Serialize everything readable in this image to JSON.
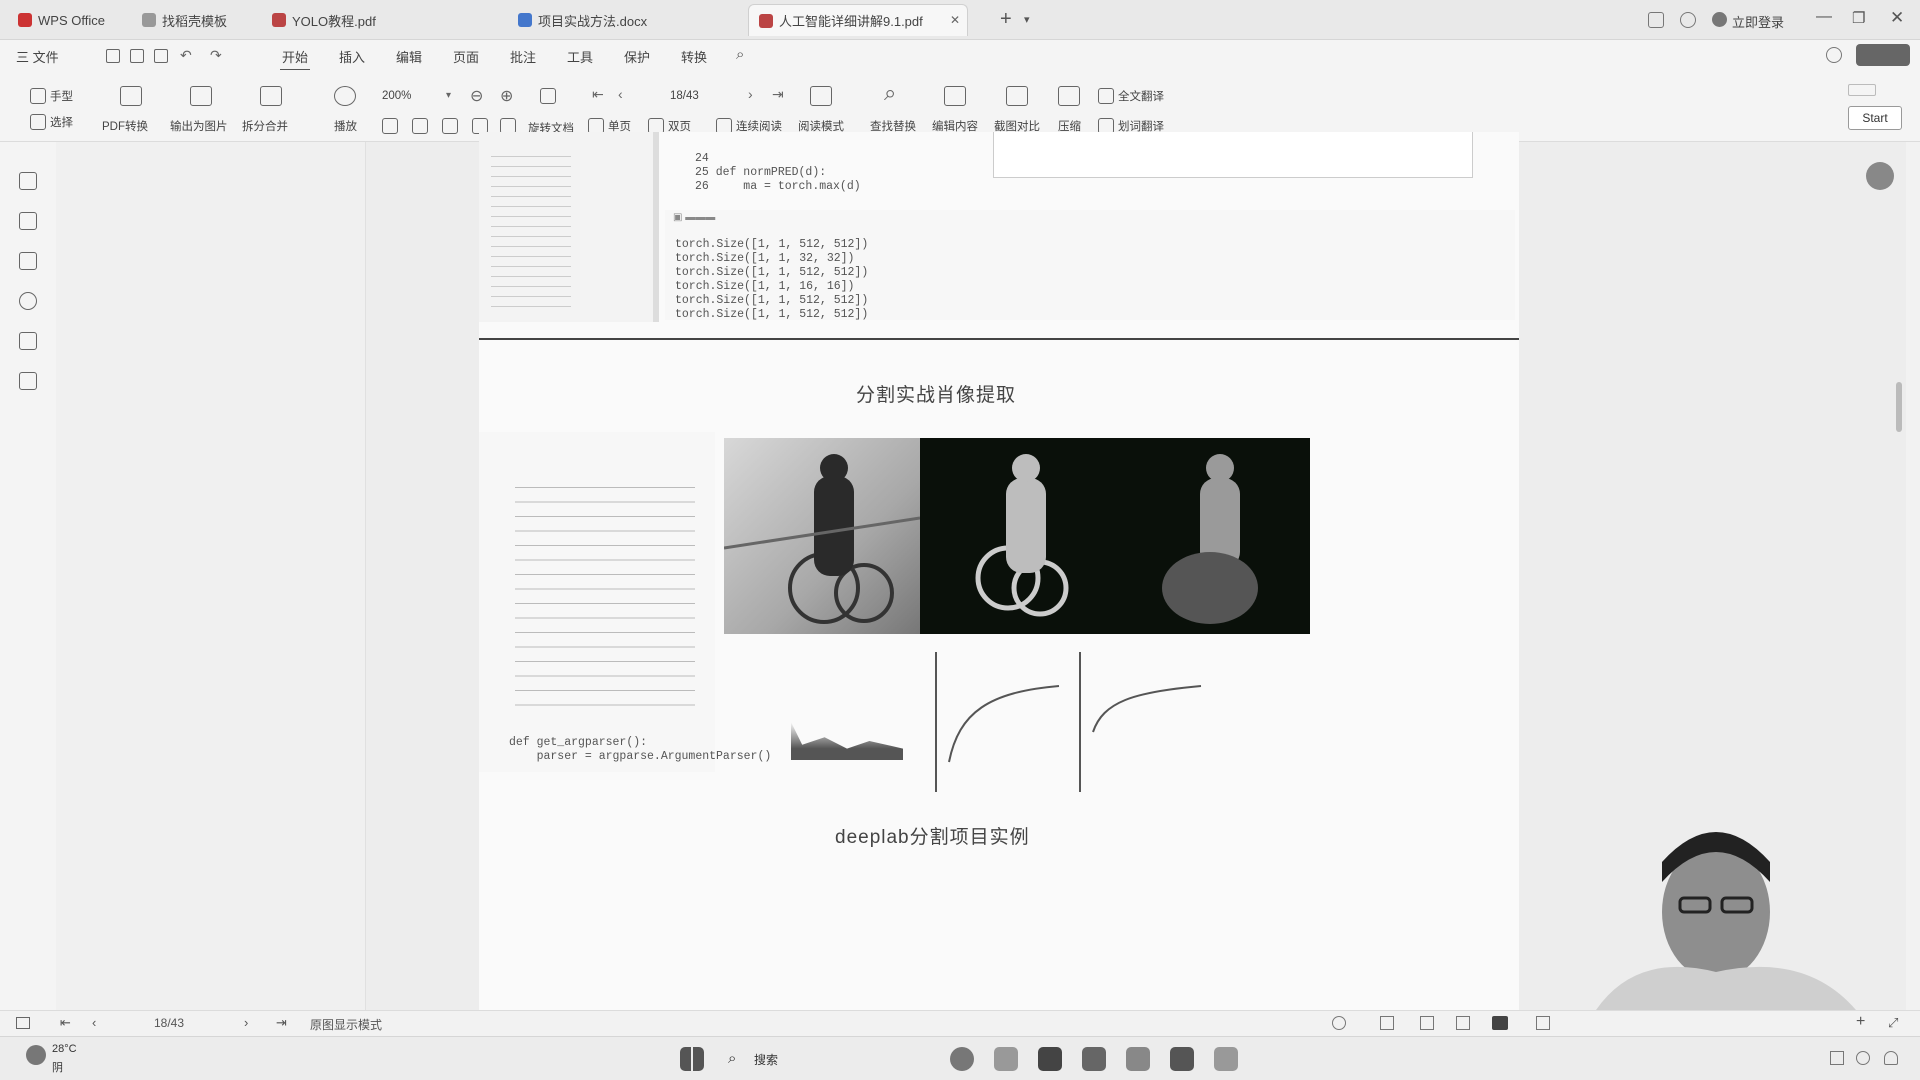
{
  "titlebar": {
    "tabs": [
      {
        "label": "WPS Office",
        "active": false
      },
      {
        "label": "找稻壳模板",
        "active": false
      },
      {
        "label": "YOLO教程.pdf",
        "active": false
      },
      {
        "label": "项目实战方法.docx",
        "active": false
      },
      {
        "label": "人工智能详细讲解9.1.pdf",
        "active": true
      }
    ],
    "login_label": "立即登录"
  },
  "menubar": {
    "file_label": "三 文件",
    "items": [
      "开始",
      "插入",
      "编辑",
      "页面",
      "批注",
      "工具",
      "保护",
      "转换"
    ],
    "active_item": "开始"
  },
  "ribbon": {
    "hand_tool": "手型",
    "select_tool": "选择",
    "pdf_convert": "PDF转换",
    "export_image": "输出为图片",
    "split_merge": "拆分合并",
    "play": "播放",
    "zoom_value": "200%",
    "rotate_doc": "旋转文档",
    "single_page": "单页",
    "double_page": "双页",
    "continuous": "连续阅读",
    "read_mode": "阅读模式",
    "find_replace": "查找替换",
    "edit_content": "编辑内容",
    "screenshot_compare": "截图对比",
    "compress": "压缩",
    "full_translate": "全文翻译",
    "translate_scan": "划词翻译",
    "page_indicator": "18/43",
    "start_button": "Start"
  },
  "document": {
    "code_top_lines": [
      "24",
      "25 def normPRED(d):",
      "26     ma = torch.max(d)"
    ],
    "console_lines": [
      "torch.Size([1, 1, 512, 512])",
      "torch.Size([1, 1, 32, 32])",
      "torch.Size([1, 1, 512, 512])",
      "torch.Size([1, 1, 16, 16])",
      "torch.Size([1, 1, 512, 512])",
      "torch.Size([1, 1, 512, 512])"
    ],
    "slide1_title": "分割实战肖像提取",
    "code_bottom_tail": [
      "def get_argparser():",
      "    parser = argparse.ArgumentParser()"
    ],
    "slide2_title": "deeplab分割项目实例"
  },
  "statusbar": {
    "page": "18/43",
    "mode_label": "原图显示模式"
  },
  "taskbar": {
    "weather_temp": "28°C",
    "weather_desc": "阴",
    "search_label": "搜索"
  }
}
